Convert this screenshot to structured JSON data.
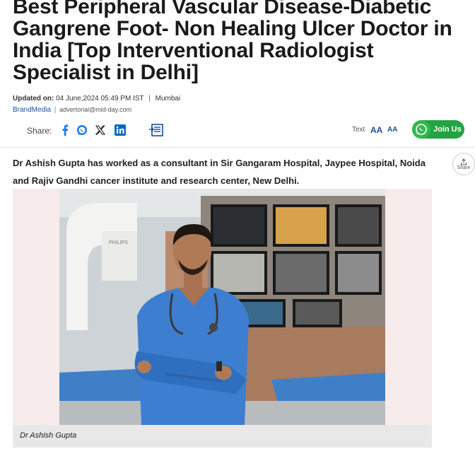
{
  "article": {
    "headline": "Best Peripheral Vascular Disease-Diabetic Gangrene Foot- Non Healing Ulcer Doctor in India [Top Interventional Radiologist Specialist in Delhi]",
    "updated_label": "Updated on:",
    "updated_value": "04 June,2024 05:49 PM IST",
    "separator": "|",
    "location": "Mumbai",
    "author": "BrandMedia",
    "author_sep": "|",
    "author_email": "advertorial@mid-day.com",
    "intro": "Dr Ashish Gupta has worked as a consultant in Sir Gangaram Hospital, Jaypee Hospital, Noida and Rajiv Gandhi cancer institute and research center, New Delhi.",
    "image_caption": "Dr Ashish Gupta",
    "image_brand_text": "PHILIPS"
  },
  "share_bar": {
    "label": "Share:",
    "icons": [
      "facebook-icon",
      "whatsapp-icon",
      "x-icon",
      "linkedin-icon",
      "copy-article-icon"
    ],
    "text_size_label": "Text",
    "text_increase": "AA",
    "text_decrease": "AA",
    "join_label": "Join Us"
  },
  "side_share": {
    "label": "Share"
  },
  "colors": {
    "link_blue": "#1a4f9c",
    "whatsapp_green": "#25a244",
    "facebook_blue": "#1877f2",
    "linkedin_blue": "#0a66c2",
    "caption_bg": "#e8e8e8",
    "figure_bg": "#f7eceb"
  }
}
